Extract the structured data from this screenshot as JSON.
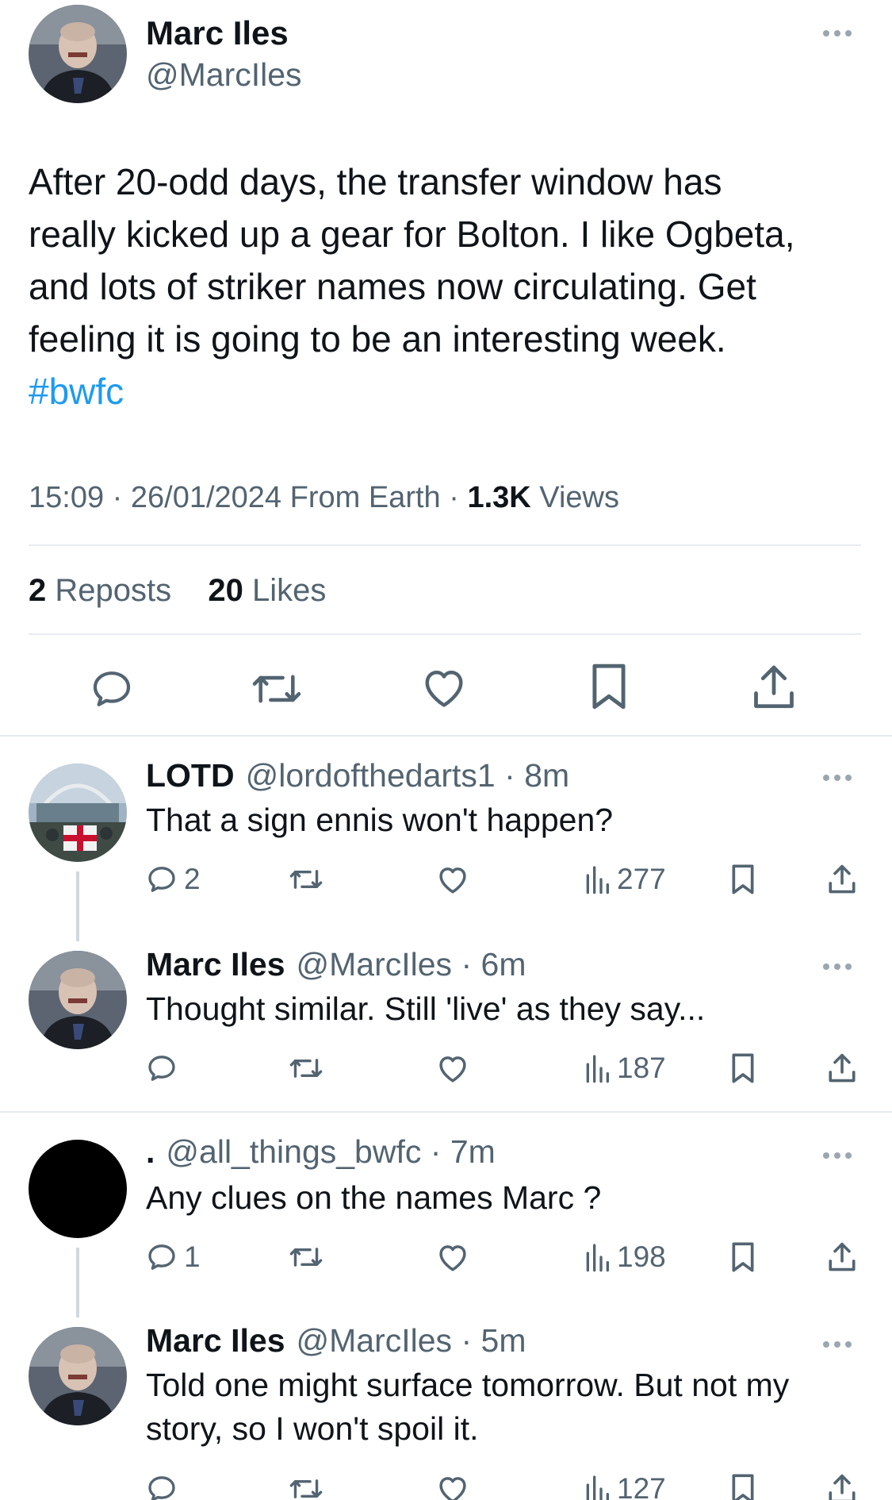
{
  "main_tweet": {
    "author_name": "Marc Iles",
    "author_handle": "@MarcIles",
    "text_lines": [
      "After 20-odd days, the transfer window has",
      "really kicked up a gear for Bolton. I like Ogbeta,",
      "and lots of striker names now circulating. Get",
      "feeling it is going to be an interesting week."
    ],
    "hashtag": "#bwfc",
    "time": "15:09",
    "date": "26/01/2024",
    "source": "From Earth",
    "views_count": "1.3K",
    "views_label": "Views",
    "reposts_count": "2",
    "reposts_label": "Reposts",
    "likes_count": "20",
    "likes_label": "Likes",
    "actions": [
      "reply-icon",
      "repost-icon",
      "like-icon",
      "bookmark-icon",
      "share-icon"
    ]
  },
  "replies": [
    {
      "name": "LOTD",
      "handle": "@lordofthedarts1",
      "time": "8m",
      "text_lines": [
        "That a sign ennis won't happen?"
      ],
      "reply_count": "2",
      "views": "277"
    },
    {
      "name": "Marc Iles",
      "handle": "@MarcIles",
      "time": "6m",
      "text_lines": [
        "Thought similar. Still 'live' as they say..."
      ],
      "reply_count": "",
      "views": "187"
    },
    {
      "name": ".",
      "handle": "@all_things_bwfc",
      "time": "7m",
      "text_lines": [
        "Any clues on the names Marc ?"
      ],
      "reply_count": "1",
      "views": "198"
    },
    {
      "name": "Marc Iles",
      "handle": "@MarcIles",
      "time": "5m",
      "text_lines": [
        "Told one might surface tomorrow. But not my",
        "story, so I won't spoil it."
      ],
      "reply_count": "",
      "views": "127"
    }
  ],
  "separator": "·",
  "colors": {
    "link": "#1d9bf0",
    "secondary_text": "#536471",
    "primary_text": "#0f1419",
    "divider": "#e6ecf0"
  }
}
